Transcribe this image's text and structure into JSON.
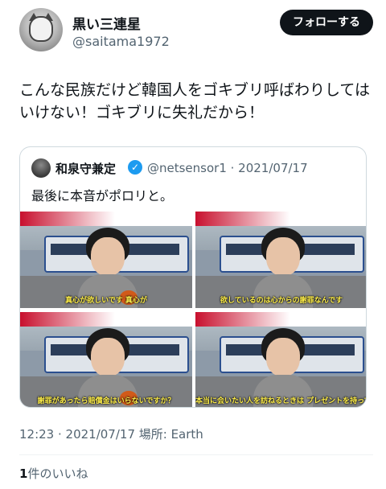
{
  "user": {
    "display_name": "黒い三連星",
    "handle": "@saitama1972",
    "avatar_icon": "cat-photo-avatar",
    "follow_label": "フォローする"
  },
  "tweet": {
    "text": "こんな民族だけど韓国人をゴキブリ呼ばわりしてはいけない！ゴキブリに失礼だから！"
  },
  "quote": {
    "name": "和泉守兼定",
    "verified_icon": "verified-badge-icon",
    "meta": "@netsensor1 · 2021/07/17",
    "text": "最後に本音がポロリと。",
    "frames": [
      {
        "caption": "真心が欲しいです 真心が"
      },
      {
        "caption": "欲しているのは心からの謝罪なんです"
      },
      {
        "caption": "謝罪があったら賠償金はいらないですか？"
      },
      {
        "caption": "本当に会いたい人を訪ねるときは プレゼントを持っていきますよね"
      }
    ]
  },
  "footer": {
    "timestamp": "12:23 · 2021/07/17 場所: Earth",
    "likes_count": "1",
    "likes_label": "件のいいね"
  },
  "colors": {
    "text": "#0f1419",
    "secondary": "#536471",
    "verified": "#1d9bf0",
    "border": "#cfd9de"
  }
}
